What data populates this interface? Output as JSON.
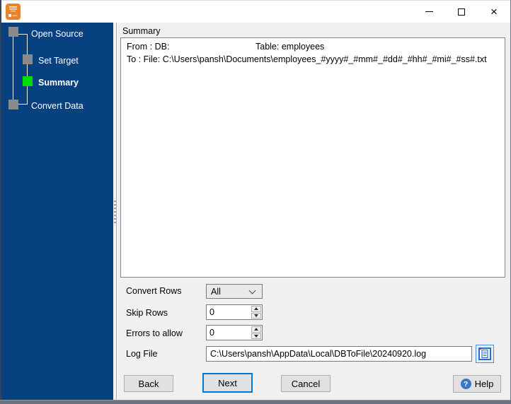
{
  "colors": {
    "sidebar_bg": "#07417f",
    "active_step_green": "#00dd00",
    "inactive_step_gray": "#8a8a8a",
    "focus_accent_blue": "#0078d7",
    "app_icon_orange": "#e8822b"
  },
  "sidebar": {
    "steps": [
      {
        "label": "Open Source",
        "state": "done"
      },
      {
        "label": "Set Target",
        "state": "done"
      },
      {
        "label": "Summary",
        "state": "active"
      },
      {
        "label": "Convert Data",
        "state": "pending"
      }
    ]
  },
  "panel": {
    "group_title": "Summary",
    "summary": {
      "from_label": "From : DB:",
      "table_label": "Table: employees",
      "to_label": "To : File: C:\\Users\\pansh\\Documents\\employees_#yyyy#_#mm#_#dd#_#hh#_#mi#_#ss#.txt"
    },
    "form": {
      "convert_rows_label": "Convert Rows",
      "convert_rows_value": "All",
      "skip_rows_label": "Skip Rows",
      "skip_rows_value": "0",
      "errors_label": "Errors to allow",
      "errors_value": "0",
      "log_file_label": "Log File",
      "log_file_value": "C:\\Users\\pansh\\AppData\\Local\\DBToFile\\20240920.log"
    }
  },
  "buttons": {
    "back": "Back",
    "next": "Next",
    "cancel": "Cancel",
    "help": "Help"
  }
}
